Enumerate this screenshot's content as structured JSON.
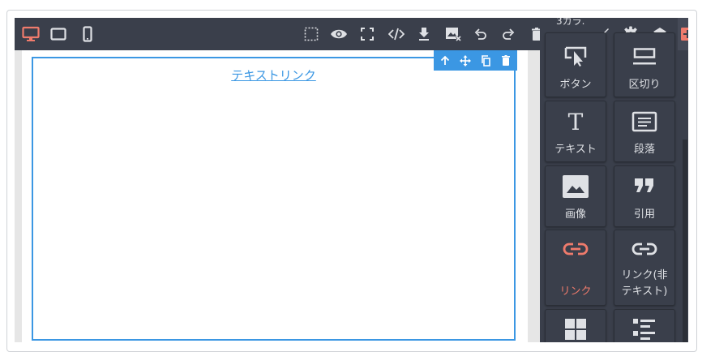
{
  "toolbar": {
    "device_active_color": "#ef7b6c",
    "icons": [
      "desktop-icon",
      "tablet-icon",
      "mobile-icon",
      "select-region-icon",
      "eye-icon",
      "fullscreen-icon",
      "code-icon",
      "download-icon",
      "remove-image-icon",
      "undo-icon",
      "redo-icon",
      "trash-icon",
      "brush-icon",
      "gear-icon",
      "layers-icon",
      "blocks-icon"
    ]
  },
  "canvas": {
    "text_link": "テキストリンク",
    "element_toolbar_icons": [
      "arrow-up-icon",
      "move-icon",
      "copy-icon",
      "trash-icon"
    ]
  },
  "panel": {
    "title": "3カラ.",
    "blocks": [
      {
        "label": "ボタン",
        "icon": "button-icon"
      },
      {
        "label": "区切り",
        "icon": "divider-icon"
      },
      {
        "label": "テキスト",
        "icon": "text-icon"
      },
      {
        "label": "段落",
        "icon": "paragraph-icon"
      },
      {
        "label": "画像",
        "icon": "image-icon"
      },
      {
        "label": "引用",
        "icon": "quote-icon"
      },
      {
        "label": "リンク",
        "icon": "link-icon",
        "active": true
      },
      {
        "label": "リンク(非テキスト)",
        "label_line1": "リンク(非",
        "label_line2": "テキスト)",
        "icon": "link-block-icon"
      },
      {
        "label": "",
        "icon": "grid-icon"
      },
      {
        "label": "",
        "icon": "list-icon"
      }
    ]
  },
  "colors": {
    "toolbar_bg": "#3a3f4b",
    "accent": "#3b97e3",
    "active": "#ef7b6c",
    "icon": "#dfe1e5"
  }
}
